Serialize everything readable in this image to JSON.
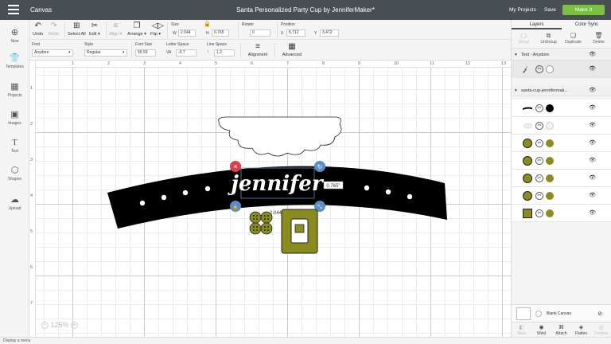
{
  "app": {
    "section": "Canvas",
    "title": "Santa Personalized Party Cup by JenniferMaker*",
    "my_projects": "My Projects",
    "save": "Save",
    "make_it": "Make It",
    "accent": "#7ac143"
  },
  "toolbar": {
    "undo": "Undo",
    "redo": "Redo",
    "select_all": "Select All",
    "edit": "Edit ▾",
    "align": "Align ▾",
    "arrange": "Arrange ▾",
    "flip": "Flip ▾",
    "size_label": "Size",
    "w_label": "W",
    "w_value": "2.044",
    "h_label": "H",
    "h_value": "0.765",
    "rotate_label": "Rotate",
    "rotate_value": "0",
    "position_label": "Position",
    "x_label": "X",
    "x_value": "5.712",
    "y_label": "Y",
    "y_value": "3.472",
    "font_label": "Font",
    "font_value": "Anydore",
    "style_label": "Style",
    "style_value": "Regular",
    "font_size_label": "Font Size",
    "font_size_value": "56.59",
    "letter_space_label": "Letter Space",
    "letter_space_value": "-0.7",
    "line_space_label": "Line Space",
    "line_space_value": "1.2",
    "alignment": "Alignment",
    "advanced": "Advanced"
  },
  "leftbar": {
    "items": [
      {
        "label": "New",
        "icon": "plus-icon"
      },
      {
        "label": "Templates",
        "icon": "shirt-icon"
      },
      {
        "label": "Projects",
        "icon": "grid-icon"
      },
      {
        "label": "Images",
        "icon": "image-icon"
      },
      {
        "label": "Text",
        "icon": "text-icon"
      },
      {
        "label": "Shapes",
        "icon": "shapes-icon"
      },
      {
        "label": "Upload",
        "icon": "upload-icon"
      }
    ]
  },
  "rulers": {
    "top": [
      "1",
      "2",
      "3",
      "4",
      "5",
      "6",
      "7",
      "8",
      "9",
      "10",
      "11",
      "12",
      "13"
    ],
    "left": [
      "1",
      "2",
      "3",
      "4",
      "5",
      "6",
      "7"
    ]
  },
  "canvas": {
    "text": "jennifer",
    "width_readout": "2.044\"",
    "height_readout": "0.765\"",
    "zoom": "125%"
  },
  "panel": {
    "tab_layers": "Layers",
    "tab_color_sync": "Color Sync",
    "group": "Group",
    "ungroup": "UnGroup",
    "duplicate": "Duplicate",
    "delete": "Delete",
    "group1": "Text - Anydore",
    "group2": "santa-cup-jennifermak...",
    "blank_canvas": "Blank Canvas",
    "slice": "Slice",
    "weld": "Weld",
    "attach": "Attach",
    "flatten": "Flatten",
    "contour": "Contour",
    "colors": {
      "olive": "#8a8c1f",
      "black": "#000000",
      "white": "#ffffff"
    }
  },
  "status": {
    "text": "Display a menu"
  }
}
